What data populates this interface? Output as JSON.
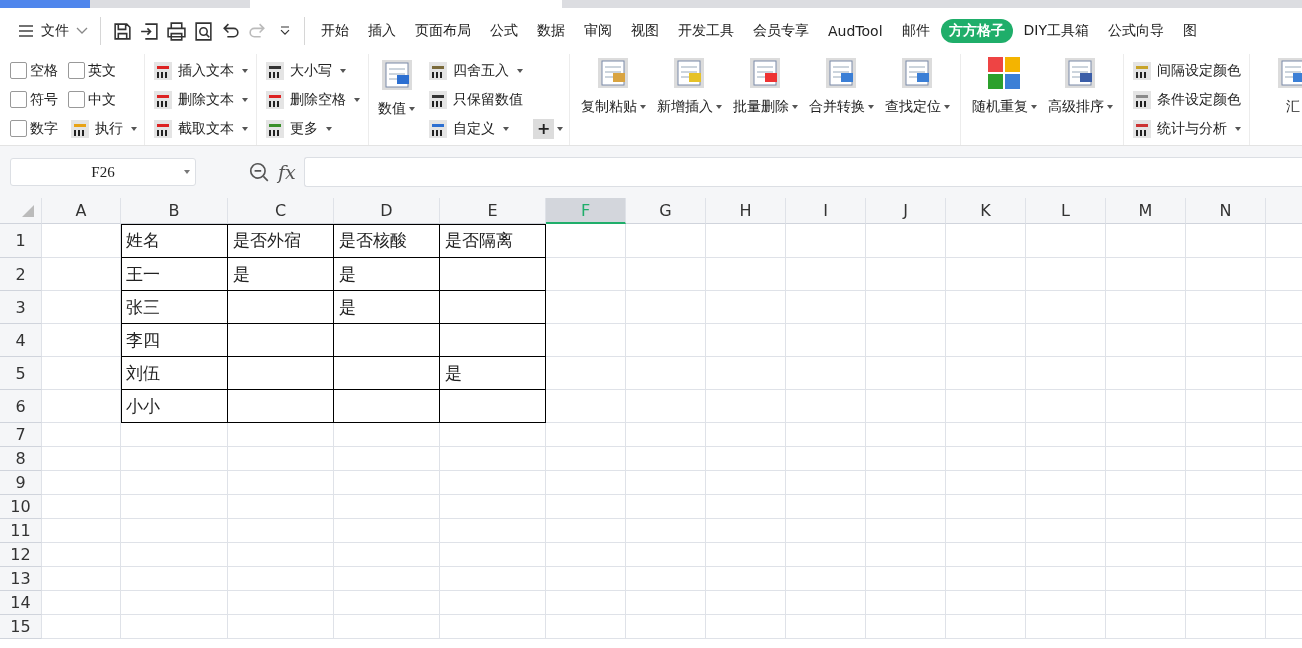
{
  "menu": {
    "file": "文件",
    "quick_access": [
      {
        "kind": "save",
        "disabled": false
      },
      {
        "kind": "export",
        "disabled": false
      },
      {
        "kind": "print",
        "disabled": false
      },
      {
        "kind": "preview",
        "disabled": false
      },
      {
        "kind": "undo",
        "disabled": false
      },
      {
        "kind": "redo",
        "disabled": true
      },
      {
        "kind": "more",
        "disabled": false
      }
    ],
    "tabs": [
      {
        "label": "开始",
        "selected": false
      },
      {
        "label": "插入",
        "selected": false
      },
      {
        "label": "页面布局",
        "selected": false
      },
      {
        "label": "公式",
        "selected": false
      },
      {
        "label": "数据",
        "selected": false
      },
      {
        "label": "审阅",
        "selected": false
      },
      {
        "label": "视图",
        "selected": false
      },
      {
        "label": "开发工具",
        "selected": false
      },
      {
        "label": "会员专享",
        "selected": false
      },
      {
        "label": "AudTool",
        "selected": false
      },
      {
        "label": "邮件",
        "selected": false
      },
      {
        "label": "方方格子",
        "selected": true
      },
      {
        "label": "DIY工具箱",
        "selected": false
      },
      {
        "label": "公式向导",
        "selected": false
      },
      {
        "label": "图",
        "selected": false
      }
    ]
  },
  "ribbon": {
    "groups": [
      {
        "kind": "options",
        "items": [
          {
            "kind": "checkbox",
            "label": "空格",
            "checked": false
          },
          {
            "kind": "checkbox",
            "label": "英文",
            "checked": false
          },
          {
            "kind": "checkbox",
            "label": "符号",
            "checked": false
          },
          {
            "kind": "checkbox",
            "label": "中文",
            "checked": false
          },
          {
            "kind": "checkbox",
            "label": "数字",
            "checked": false
          },
          {
            "kind": "small",
            "label": "执行",
            "dropdown": true
          }
        ]
      },
      {
        "kind": "stack",
        "items": [
          {
            "kind": "small",
            "label": "插入文本",
            "dropdown": true
          },
          {
            "kind": "small",
            "label": "删除文本",
            "dropdown": true
          },
          {
            "kind": "small",
            "label": "截取文本",
            "dropdown": true
          }
        ]
      },
      {
        "kind": "stack",
        "items": [
          {
            "kind": "small",
            "label": "大小写",
            "dropdown": true
          },
          {
            "kind": "small",
            "label": "删除空格",
            "dropdown": true
          },
          {
            "kind": "small",
            "label": "更多",
            "dropdown": true
          }
        ]
      },
      {
        "kind": "mixed",
        "items": [
          {
            "kind": "large",
            "label": "数值",
            "dropdown": true
          },
          {
            "kind": "small",
            "label": "四舍五入",
            "dropdown": true
          },
          {
            "kind": "small",
            "label": "只保留数值",
            "dropdown": false
          },
          {
            "kind": "small",
            "label": "自定义",
            "dropdown": true
          },
          {
            "kind": "plus",
            "label": "+",
            "dropdown": true
          }
        ]
      },
      {
        "kind": "row",
        "items": [
          {
            "kind": "large",
            "label": "复制粘贴",
            "dropdown": true
          },
          {
            "kind": "large",
            "label": "新增插入",
            "dropdown": true
          },
          {
            "kind": "large",
            "label": "批量删除",
            "dropdown": true
          },
          {
            "kind": "large",
            "label": "合并转换",
            "dropdown": true
          },
          {
            "kind": "large",
            "label": "查找定位",
            "dropdown": true
          }
        ]
      },
      {
        "kind": "row",
        "items": [
          {
            "kind": "large",
            "label": "随机重复",
            "dropdown": true
          },
          {
            "kind": "large",
            "label": "高级排序",
            "dropdown": true
          }
        ]
      },
      {
        "kind": "stack",
        "items": [
          {
            "kind": "small",
            "label": "间隔设定颜色",
            "dropdown": false
          },
          {
            "kind": "small",
            "label": "条件设定颜色",
            "dropdown": false
          },
          {
            "kind": "small",
            "label": "统计与分析",
            "dropdown": true
          }
        ]
      },
      {
        "kind": "row",
        "items": [
          {
            "kind": "large",
            "label": "汇",
            "dropdown": false
          }
        ]
      }
    ]
  },
  "formula_bar": {
    "name_box": "F26",
    "fx": "fx"
  },
  "sheet": {
    "columns": [
      {
        "label": "A",
        "selected": false
      },
      {
        "label": "B",
        "selected": false
      },
      {
        "label": "C",
        "selected": false
      },
      {
        "label": "D",
        "selected": false
      },
      {
        "label": "E",
        "selected": false
      },
      {
        "label": "F",
        "selected": true
      },
      {
        "label": "G",
        "selected": false
      },
      {
        "label": "H",
        "selected": false
      },
      {
        "label": "I",
        "selected": false
      },
      {
        "label": "J",
        "selected": false
      },
      {
        "label": "K",
        "selected": false
      },
      {
        "label": "L",
        "selected": false
      },
      {
        "label": "M",
        "selected": false
      },
      {
        "label": "N",
        "selected": false
      }
    ],
    "rows": [
      {
        "number": "1",
        "bordered": true,
        "cells": {
          "B": "姓名",
          "C": "是否外宿",
          "D": "是否核酸",
          "E": "是否隔离"
        }
      },
      {
        "number": "2",
        "bordered": true,
        "cells": {
          "B": "王一",
          "C": "是",
          "D": "是"
        }
      },
      {
        "number": "3",
        "bordered": true,
        "cells": {
          "B": "张三",
          "D": "是"
        }
      },
      {
        "number": "4",
        "bordered": true,
        "cells": {
          "B": "李四"
        }
      },
      {
        "number": "5",
        "bordered": true,
        "cells": {
          "B": "刘伍",
          "E": "是"
        }
      },
      {
        "number": "6",
        "bordered": true,
        "cells": {
          "B": "小小"
        }
      },
      {
        "number": "7",
        "bordered": false,
        "cells": {}
      },
      {
        "number": "8",
        "bordered": false,
        "cells": {}
      },
      {
        "number": "9",
        "bordered": false,
        "cells": {}
      },
      {
        "number": "10",
        "bordered": false,
        "cells": {}
      },
      {
        "number": "11",
        "bordered": false,
        "cells": {}
      },
      {
        "number": "12",
        "bordered": false,
        "cells": {}
      },
      {
        "number": "13",
        "bordered": false,
        "cells": {}
      },
      {
        "number": "14",
        "bordered": false,
        "cells": {}
      },
      {
        "number": "15",
        "bordered": false,
        "cells": {}
      }
    ]
  }
}
